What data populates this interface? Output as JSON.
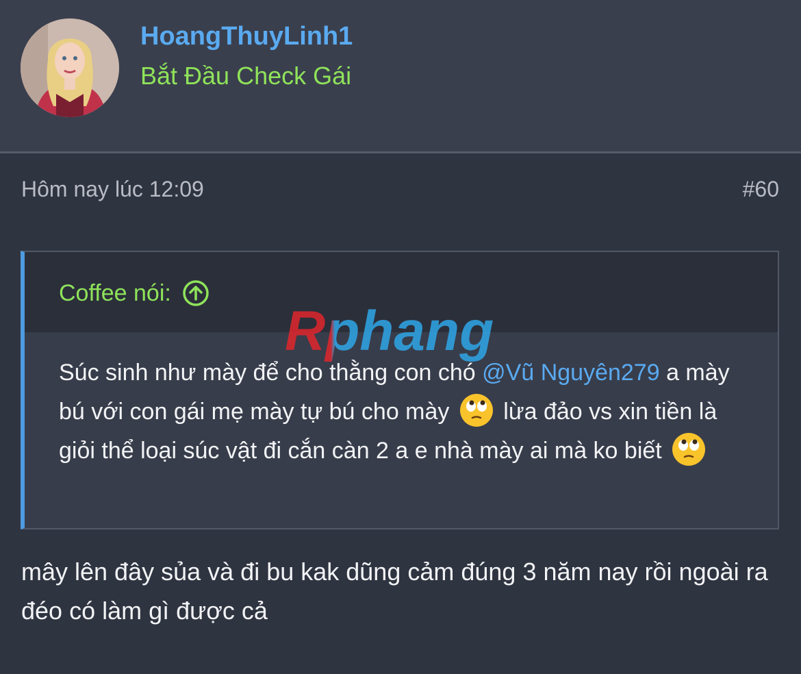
{
  "post": {
    "author": {
      "username": "HoangThuyLinh1",
      "user_title": "Bắt Đầu Check Gái"
    },
    "time": "Hôm nay lúc 12:09",
    "post_number": "#60",
    "quote": {
      "attribution": "Coffee nói:",
      "text_part1": "Súc sinh như mày để cho thằng con chó ",
      "mention": "@Vũ Nguyên279",
      "text_part2": " a mày bú với con gái mẹ mày tự bú cho mày ",
      "text_part3": " lừa đảo vs xin tiền là giỏi thể loại súc vật đi cắn càn 2 a e nhà mày ai mà ko biết ",
      "emoji": "face-with-rolling-eyes-icon"
    },
    "reply": "mây lên đây sủa và đi bu kak dũng cảm đúng 3 năm nay rồi ngoài ra đéo có làm gì được cả"
  },
  "watermark": "Rphang",
  "colors": {
    "username": "#5aaaf0",
    "user_title": "#8fe35a",
    "quote_bar": "#4f9be0",
    "background": "#2f3441"
  }
}
